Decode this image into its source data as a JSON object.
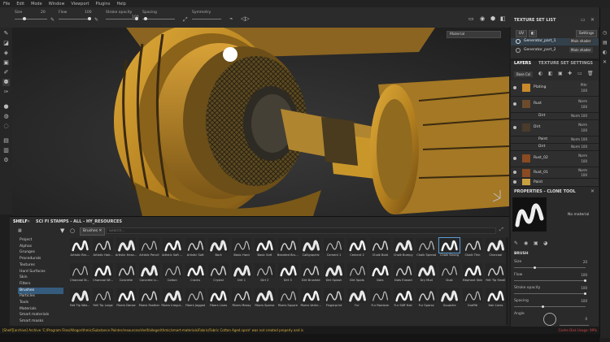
{
  "menu": [
    "File",
    "Edit",
    "Mode",
    "Window",
    "Viewport",
    "Plugins",
    "Help"
  ],
  "toolbar": {
    "size_label": "Size",
    "size_value": "20",
    "flow_label": "Flow",
    "flow_value": "100",
    "stroke_label": "Stroke opacity",
    "stroke_value": "100",
    "spacing_label": "Spacing",
    "spacing_value": "",
    "symmetry_label": "Symmetry"
  },
  "viewport": {
    "material_select": "Material"
  },
  "texture_set": {
    "title": "TEXTURE SET LIST",
    "btn_uv": "UV",
    "btn_settings": "Settings",
    "items": [
      {
        "name": "Generator_part_1",
        "shader": "Main shader"
      },
      {
        "name": "Generator_part_2",
        "shader": "Main shader"
      }
    ]
  },
  "layers": {
    "tab1": "LAYERS",
    "tab2": "TEXTURE SET SETTINGS",
    "channel": "Base Col",
    "rows": [
      {
        "name": "Plating",
        "blend": "Pthr",
        "op": "100",
        "color": "#c98a2c"
      },
      {
        "name": "Rust",
        "blend": "Norm",
        "op": "100",
        "color": "#6b4b2a"
      },
      {
        "name": "Dirt",
        "blend": "Norm",
        "op": "100",
        "color": "#3c3c3c"
      },
      {
        "name": "Dirt",
        "blend": "Norm",
        "op": "100",
        "color": "#4a3a2a"
      },
      {
        "name": "Paint",
        "blend": "Norm",
        "op": "100",
        "color": "#2c2c2c"
      },
      {
        "name": "Dirt",
        "blend": "Norm",
        "op": "100",
        "color": "#2c2c2c"
      },
      {
        "name": "Rust_02",
        "blend": "Norm",
        "op": "100",
        "color": "#8a4a22"
      },
      {
        "name": "Rust_01",
        "blend": "Norm",
        "op": "100",
        "color": "#8a4a22"
      },
      {
        "name": "Paint",
        "blend": "",
        "op": "",
        "color": "#c9a040"
      }
    ]
  },
  "properties": {
    "title": "PROPERTIES - CLONE TOOL",
    "no_material": "No material",
    "brush_header": "BRUSH",
    "size_label": "Size",
    "size_value": "20",
    "flow_label": "Flow",
    "flow_value": "100",
    "stroke_label": "Stroke opacity",
    "stroke_value": "100",
    "spacing_label": "Spacing",
    "spacing_value": "100",
    "angle_label": "Angle",
    "angle_value": "0"
  },
  "shelf": {
    "tabs": [
      "SHELF",
      "SCI FI STAMPS - ALL - HY_RESOURCES"
    ],
    "filter_chip": "Brushes",
    "search_placeholder": "Search...",
    "categories": [
      "Project",
      "Alphas",
      "Grunges",
      "Procedurals",
      "Textures",
      "Hard Surfaces",
      "Skin",
      "Filters",
      "Brushes",
      "Particles",
      "Tools",
      "Materials",
      "Smart materials",
      "Smart masks"
    ],
    "selected_category": "Brushes",
    "selected_item": "Chalk Strong",
    "items": [
      "Artistic Bru...",
      "Artistic Hair...",
      "Artistic Heav...",
      "Artistic Pencil",
      "Artistic Soft ...",
      "Artistic Soft",
      "Bark",
      "Basic Hard",
      "Basic Soft",
      "Bearded Bru...",
      "Calligraphic",
      "Cement 1",
      "Cement 2",
      "Chalk Bold",
      "Chalk Bumpy",
      "Chalk Spread",
      "Chalk Strong",
      "Chalk Thin",
      "Charcoal",
      "Charcoal St...",
      "Charcoal Wi...",
      "Concrete",
      "Concrete Li...",
      "Cotton",
      "Cracks",
      "Crystal",
      "Dirt 1",
      "Dirt 2",
      "Dirt 3",
      "Dirt Brushed",
      "Dirt Splash",
      "Dirt Spots",
      "Dots",
      "Dots Erased",
      "Dry Mud",
      "Dust",
      "Elephant Skin",
      "Felt Tip Small",
      "Felt Tip Wat...",
      "Felt Tip Large",
      "Fibers Dense",
      "Fibers Feather",
      "Fibers Irregul...",
      "Fibers Jagged",
      "Fibers Lines",
      "Fibers Messy",
      "Fibers Sparse",
      "Fibers Square",
      "Fibers Vertic...",
      "Fingerprint",
      "Fur",
      "Fur Random",
      "Fur Stiff Hair",
      "Fur Sparse",
      "Gouache",
      "Graffiti",
      "Hair Lines"
    ]
  },
  "status": {
    "message": "[Shelf][archive] Archive 'C:/Program Files/Allegorithmic/Substance Painter/resources/shelf/allegorithmic/smart-materials/Fabric/Fabric Cotton Aged.spsm' was not created properly and is",
    "right": "Cache Disk Usage: 99%"
  },
  "colors": {
    "accent": "#5b9bd5",
    "status_warning": "#d8b23c",
    "status_error": "#d04848",
    "paint_yellow": "#c9962a"
  }
}
